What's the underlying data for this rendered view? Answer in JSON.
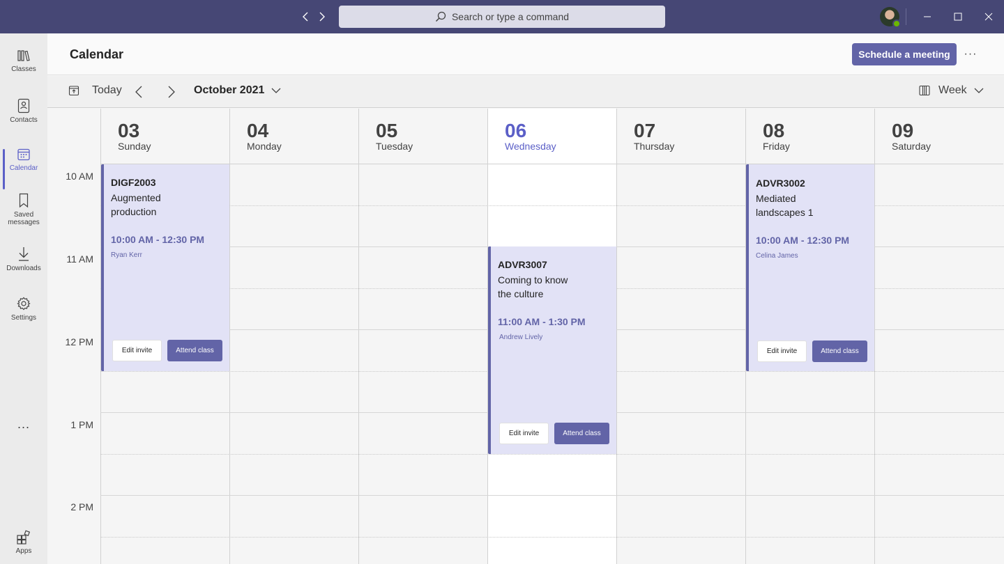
{
  "titlebar": {
    "search_placeholder": "Search or type a command"
  },
  "rail": {
    "items": [
      {
        "label": "Classes",
        "icon": "books-icon"
      },
      {
        "label": "Contacts",
        "icon": "contact-card-icon"
      },
      {
        "label": "Calendar",
        "icon": "calendar-icon",
        "active": true
      },
      {
        "label": "Saved messages",
        "icon": "bookmark-icon"
      },
      {
        "label": "Downloads",
        "icon": "download-icon"
      },
      {
        "label": "Settings",
        "icon": "gear-icon"
      }
    ],
    "more": "...",
    "apps_label": "Apps"
  },
  "header": {
    "title": "Calendar",
    "schedule_label": "Schedule a meeting",
    "more": "···"
  },
  "toolbar": {
    "today_label": "Today",
    "month_label": "October 2021",
    "view_label": "Week"
  },
  "days": [
    {
      "num": "03",
      "name": "Sunday"
    },
    {
      "num": "04",
      "name": "Monday"
    },
    {
      "num": "05",
      "name": "Tuesday"
    },
    {
      "num": "06",
      "name": "Wednesday",
      "today": true
    },
    {
      "num": "07",
      "name": "Thursday"
    },
    {
      "num": "08",
      "name": "Friday"
    },
    {
      "num": "09",
      "name": "Saturday"
    }
  ],
  "time_labels": [
    "10 AM",
    "11 AM",
    "12 PM",
    "1 PM",
    "2 PM"
  ],
  "events": [
    {
      "code": "DIGF2003",
      "title": "Augmented production",
      "time": "10:00 AM - 12:30 PM",
      "person": "Ryan Kerr",
      "edit_label": "Edit invite",
      "attend_label": "Attend class"
    },
    {
      "code": "ADVR3007",
      "title": "Coming to know the culture",
      "time": "11:00 AM - 1:30 PM",
      "person": "Andrew Lively",
      "edit_label": "Edit invite",
      "attend_label": "Attend class"
    },
    {
      "code": "ADVR3002",
      "title": "Mediated landscapes 1",
      "time": "10:00 AM - 12:30 PM",
      "person": "Celina James",
      "edit_label": "Edit invite",
      "attend_label": "Attend class"
    }
  ],
  "colors": {
    "titlebar": "#464775",
    "accent": "#6264a7",
    "event_bg": "#e2e2f6",
    "today_text": "#5b5fc7"
  }
}
